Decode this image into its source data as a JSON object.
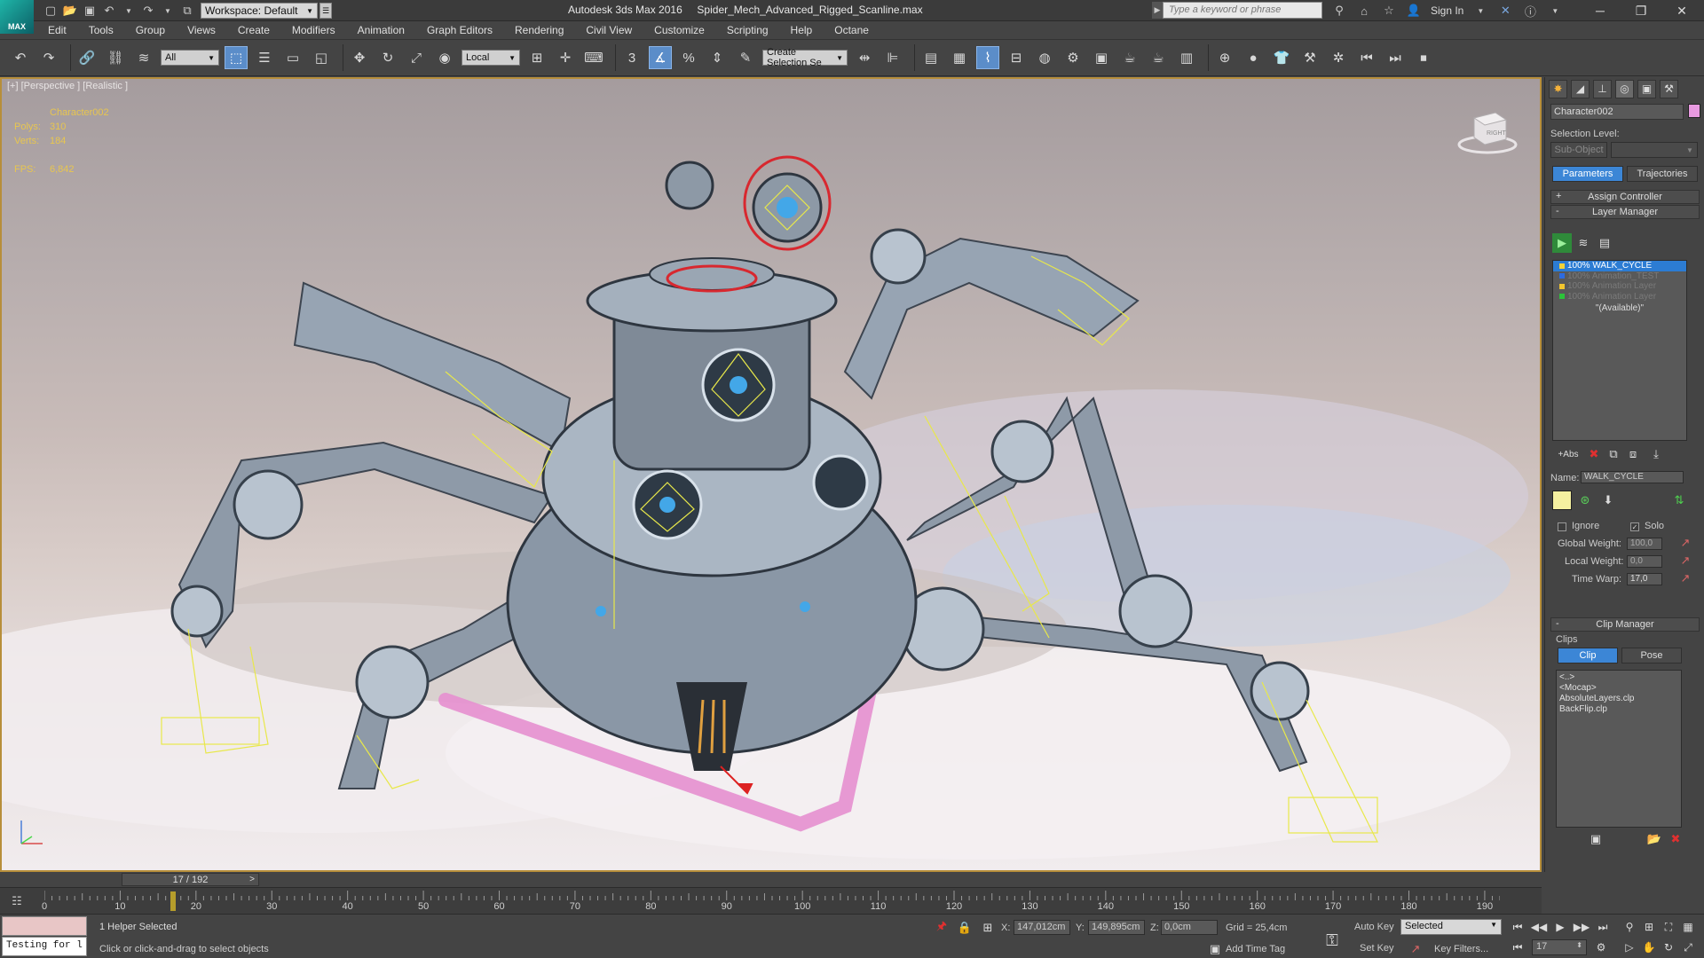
{
  "app": {
    "title": "Autodesk 3ds Max 2016",
    "file": "Spider_Mech_Advanced_Rigged_Scanline.max",
    "logo_text": "MAX",
    "workspace": "Workspace: Default",
    "search_placeholder": "Type a keyword or phrase",
    "sign_in": "Sign In"
  },
  "menu": [
    "Edit",
    "Tools",
    "Group",
    "Views",
    "Create",
    "Modifiers",
    "Animation",
    "Graph Editors",
    "Rendering",
    "Civil View",
    "Customize",
    "Scripting",
    "Help",
    "Octane"
  ],
  "toolbar": {
    "selection_filter": "All",
    "ref_coord": "Local",
    "named_selection": "Create Selection Se",
    "snap_label": "3"
  },
  "viewport": {
    "label": "[+] [Perspective ] [Realistic ]",
    "object_name": "Character002",
    "stats": [
      {
        "key": "Polys:",
        "value": "310"
      },
      {
        "key": "Verts:",
        "value": "184"
      },
      {
        "key": "FPS:",
        "value": "6,842"
      }
    ],
    "viewcube_label": "RIGHT"
  },
  "command_panel": {
    "object_name": "Character002",
    "object_color": "#e89ae0",
    "selection_level_label": "Selection Level:",
    "sub_object": "Sub-Object",
    "tab_parameters": "Parameters",
    "tab_trajectories": "Trajectories",
    "assign_controller": "Assign Controller",
    "layer_manager": "Layer Manager",
    "layers": [
      {
        "label": "100% WALK_CYCLE",
        "color": "#f2d23a",
        "selected": true
      },
      {
        "label": "100% Animation_TEST",
        "color": "#2d6be0",
        "selected": false
      },
      {
        "label": "100% Animation Layer",
        "color": "#f2c52e",
        "selected": false
      },
      {
        "label": "100% Animation Layer",
        "color": "#2cc43a",
        "selected": false
      }
    ],
    "available": "\"(Available)\"",
    "name_label": "Name:",
    "name_value": "WALK_CYCLE",
    "abs_label": "Abs",
    "ignore_label": "Ignore",
    "solo_label": "Solo",
    "global_weight_label": "Global Weight:",
    "global_weight": "100,0",
    "local_weight_label": "Local Weight:",
    "local_weight": "0,0",
    "time_warp_label": "Time Warp:",
    "time_warp": "17,0",
    "clip_manager": "Clip Manager",
    "clips_label": "Clips",
    "clip_tab": "Clip",
    "pose_tab": "Pose",
    "clips": [
      "<..>",
      "<Mocap>",
      "AbsoluteLayers.clp",
      "BackFlip.clp"
    ]
  },
  "timeline": {
    "time_slider": "17 / 192",
    "current_frame": 17,
    "total_frames": 192,
    "tick_labels": [
      "0",
      "10",
      "20",
      "30",
      "40",
      "50",
      "60",
      "70",
      "80",
      "90",
      "100",
      "110",
      "120",
      "130",
      "140",
      "150",
      "160",
      "170",
      "180",
      "190"
    ]
  },
  "status": {
    "maxscript_output": "Testing for l",
    "selection": "1 Helper Selected",
    "prompt": "Click or click-and-drag to select objects",
    "x_label": "X:",
    "x": "147,012cm",
    "y_label": "Y:",
    "y": "149,895cm",
    "z_label": "Z:",
    "z": "0,0cm",
    "grid": "Grid = 25,4cm",
    "add_time_tag": "Add Time Tag",
    "auto_key": "Auto Key",
    "set_key": "Set Key",
    "key_mode": "Selected",
    "key_filters": "Key Filters...",
    "frame": "17"
  }
}
